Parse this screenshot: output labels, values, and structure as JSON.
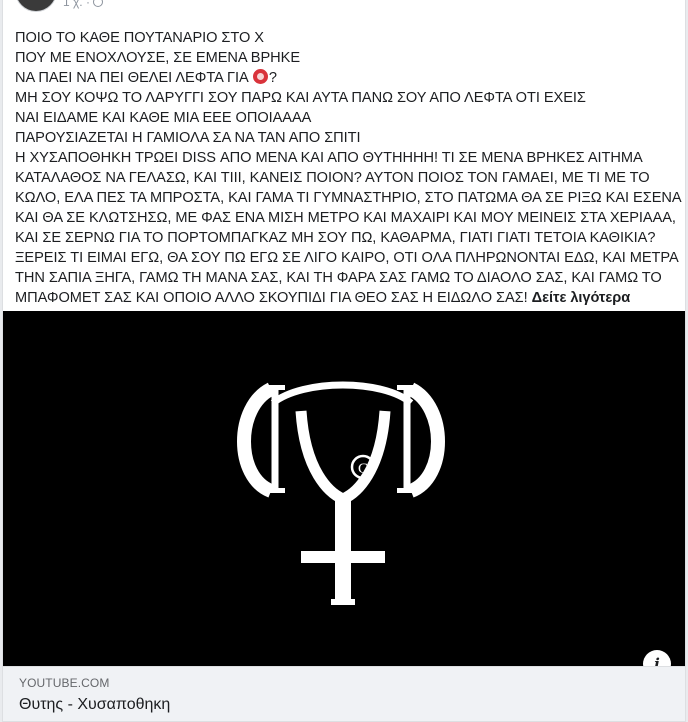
{
  "post": {
    "meta": "1 χ. ·",
    "icon": "globe-icon",
    "lines": [
      "ΠΟΙΟ ΤΟ ΚΑΘΕ ΠΟΥΤΑΝΑΡΙΟ ΣΤΟ Χ",
      "ΠΟΥ ΜΕ ΕΝΟΧΛΟΥΣΕ, ΣΕ ΕΜΕΝΑ ΒΡΗΚΕ",
      "ΝΑ ΠΑΕΙ ΝΑ ΠΕΙ ΘΕΛΕΙ ΛΕΦΤΑ ΓΙΑ",
      "?",
      "ΜΗ ΣΟΥ ΚΟΨΩ ΤΟ ΛΑΡΥΓΓΙ ΣΟΥ ΠΑΡΩ ΚΑΙ ΑΥΤΑ ΠΑΝΩ ΣΟΥ ΑΠΟ ΛΕΦΤΑ ΟΤΙ ΕΧΕΙΣ",
      "ΝΑΙ ΕΙΔΑΜΕ ΚΑΙ ΚΑΘΕ ΜΙΑ ΕΕΕ ΟΠΟΙΑΑΑΑ",
      "ΠΑΡΟΥΣΙΑΖΕΤΑΙ Η ΓΑΜΙΟΛΑ ΣΑ ΝΑ ΤΑΝ ΑΠΟ ΣΠΙΤΙ",
      "Η ΧΥΣΑΠΟΘΗΚΗ ΤΡΩΕΙ DISS ΑΠΟ ΜΕΝΑ ΚΑΙ ΑΠΟ ΘΥΤΗΗΗΗ! ΤΙ ΣΕ ΜΕΝΑ ΒΡΗΚΕΣ ΑΙΤΗΜΑ",
      "ΚΑΤΑΛΑΘΟΣ ΝΑ ΓΕΛΑΣΩ, ΚΑΙ ΤΙΙΙ, ΚΑΝΕΙΣ ΠΟΙΟΝ? ΑΥΤΟΝ ΠΟΙΟΣ ΤΟΝ ΓΑΜΑΕΙ, ΜΕ ΤΙ ΜΕ ΤΟ",
      "ΚΩΛΟ, ΕΛΑ ΠΕΣ ΤΑ ΜΠΡΟΣΤΑ, ΚΑΙ ΓΑΜΑ ΤΙ ΓΥΜΝΑΣΤΗΡΙΟ, ΣΤΟ ΠΑΤΩΜΑ ΘΑ ΣΕ ΡΙΞΩ ΚΑΙ ΕΣΕΝΑ",
      "ΚΑΙ ΘΑ ΣΕ ΚΛΩΤΣΗΣΩ, ΜΕ ΦΑΣ ΕΝΑ ΜΙΣΗ ΜΕΤΡΟ ΚΑΙ ΜΑΧΑΙΡΙ ΚΑΙ ΜΟΥ ΜΕΙΝΕΙΣ ΣΤΑ ΧΕΡΙΑΑΑ,",
      "ΚΑΙ ΣΕ ΣΕΡΝΩ ΓΙΑ ΤΟ ΠΟΡΤΟΜΠΑΓΚΑΖ ΜΗ ΣΟΥ ΠΩ, ΚΑΘΑΡΜΑ, ΓΙΑΤΙ ΓΙΑΤΙ ΤΕΤΟΙΑ ΚΑΘΙΚΙΑ?",
      "ΞΕΡΕΙΣ ΤΙ ΕΙΜΑΙ ΕΓΩ, ΘΑ ΣΟΥ ΠΩ ΕΓΩ ΣΕ ΛΙΓΟ ΚΑΙΡΟ, ΟΤΙ ΟΛΑ ΠΛΗΡΩΝΟΝΤΑΙ ΕΔΩ, ΚΑΙ ΜΕΤΡΑ",
      "ΤΗΝ ΣΑΠΙΑ ΞΗΓΑ, ΓΑΜΩ ΤΗ ΜΑΝΑ ΣΑΣ, ΚΑΙ ΤΗ ΦΑΡΑ ΣΑΣ ΓΑΜΩ ΤΟ ΔΙΑΟΛΟ ΣΑΣ, ΚΑΙ ΓΑΜΩ ΤΟ",
      "ΜΠΑΦΟΜΕΤ ΣΑΣ ΚΑΙ ΟΠΟΙΟ ΑΛΛΟ ΣΚΟΥΠΙΔΙ ΓΙΑ ΘΕΟ ΣΑΣ Η ΕΙΔΩΛΟ ΣΑΣ!"
    ],
    "see_more": "Δείτε λιγότερα",
    "emoji_icon": "no-entry-emoji-icon"
  },
  "link": {
    "domain": "YOUTUBE.COM",
    "title": "Θυτης - Χυσαποθηκη",
    "logo_letter": "C",
    "info_label": "i"
  },
  "colors": {
    "media_bg": "#000000",
    "logo": "#ffffff",
    "footer_bg": "#f0f2f5"
  }
}
